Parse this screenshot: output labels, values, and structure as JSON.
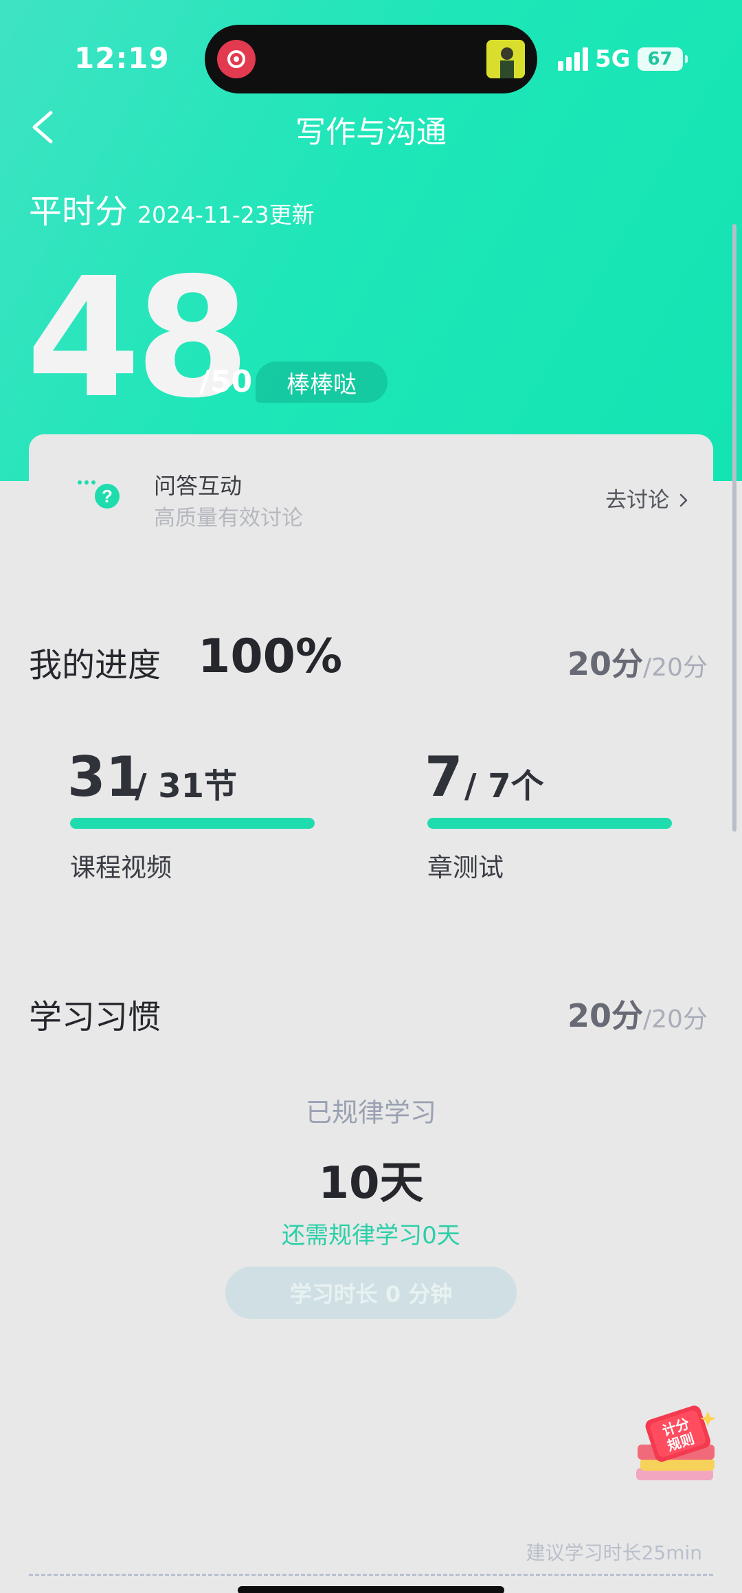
{
  "status_bar": {
    "time": "12:19",
    "network": "5G",
    "battery": "67"
  },
  "nav": {
    "title": "写作与沟通"
  },
  "score": {
    "label": "平时分",
    "updated": "2024-11-23更新",
    "value": "48",
    "total": "/50",
    "badge": "棒棒哒"
  },
  "qa": {
    "title": "问答互动",
    "subtitle": "高质量有效讨论",
    "link": "去讨论"
  },
  "progress": {
    "title": "我的进度",
    "percent": "100%",
    "points": "20分",
    "points_total": "/20分",
    "items": [
      {
        "done": "31",
        "total": "/ 31节",
        "label": "课程视频",
        "fraction": 1.0
      },
      {
        "done": "7",
        "total": "/ 7个",
        "label": "章测试",
        "fraction": 1.0
      }
    ]
  },
  "habit": {
    "title": "学习习惯",
    "points": "20分",
    "points_total": "/20分",
    "regular_label": "已规律学习",
    "days": "10天",
    "need": "还需规律学习0天",
    "study_time_button": "学习时长 0 分钟",
    "suggest": "建议学习时长25min"
  },
  "rules_badge": {
    "text_line1": "计分",
    "text_line2": "规则"
  },
  "colors": {
    "accent": "#1fdcae",
    "hero": "#1ee6b8"
  }
}
